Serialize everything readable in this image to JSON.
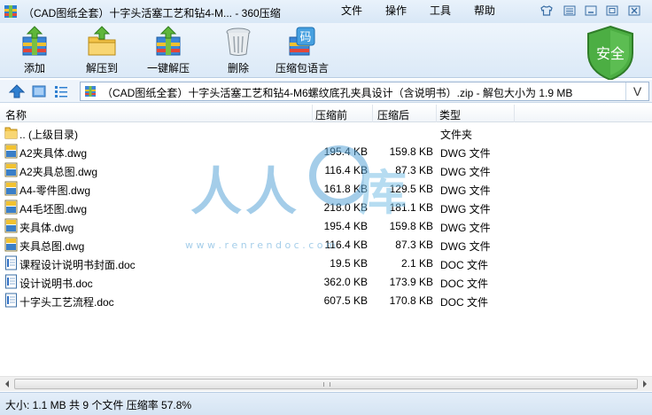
{
  "window": {
    "title": "（CAD图纸全套）十字头活塞工艺和钻4-M... - 360压缩",
    "app_icon": "archive-app-icon",
    "menu": [
      "文件",
      "操作",
      "工具",
      "帮助"
    ],
    "controls": [
      "shirt-icon",
      "menu-lines-icon",
      "minimize-icon",
      "maximize-icon",
      "close-icon"
    ]
  },
  "toolbar": {
    "buttons": [
      {
        "label": "添加",
        "icon": "add-to-archive-icon"
      },
      {
        "label": "解压到",
        "icon": "extract-to-folder-icon"
      },
      {
        "label": "一键解压",
        "icon": "one-click-extract-icon"
      },
      {
        "label": "删除",
        "icon": "trash-can-icon"
      },
      {
        "label": "压缩包语言",
        "icon": "archive-language-icon"
      }
    ],
    "lang_glyph": "码",
    "security_label": "安全",
    "security_color": "#3fa53a"
  },
  "address": {
    "text": "（CAD图纸全套）十字头活塞工艺和钻4-M6螺纹底孔夹具设计（含说明书）.zip - 解包大小为 1.9 MB",
    "dropdown_glyph": "V"
  },
  "columns": {
    "name": "名称",
    "size": "压缩前",
    "packed": "压缩后",
    "type": "类型"
  },
  "files": [
    {
      "name": ".. (上级目录)",
      "size": "",
      "packed": "",
      "type": "文件夹",
      "icon": "folder"
    },
    {
      "name": "A2夹具体.dwg",
      "size": "195.4 KB",
      "packed": "159.8 KB",
      "type": "DWG 文件",
      "icon": "dwg"
    },
    {
      "name": "A2夹具总图.dwg",
      "size": "116.4 KB",
      "packed": "87.3 KB",
      "type": "DWG 文件",
      "icon": "dwg"
    },
    {
      "name": "A4-零件图.dwg",
      "size": "161.8 KB",
      "packed": "129.5 KB",
      "type": "DWG 文件",
      "icon": "dwg"
    },
    {
      "name": "A4毛坯图.dwg",
      "size": "218.0 KB",
      "packed": "181.1 KB",
      "type": "DWG 文件",
      "icon": "dwg"
    },
    {
      "name": "夹具体.dwg",
      "size": "195.4 KB",
      "packed": "159.8 KB",
      "type": "DWG 文件",
      "icon": "dwg"
    },
    {
      "name": "夹具总图.dwg",
      "size": "116.4 KB",
      "packed": "87.3 KB",
      "type": "DWG 文件",
      "icon": "dwg"
    },
    {
      "name": "课程设计说明书封面.doc",
      "size": "19.5 KB",
      "packed": "2.1 KB",
      "type": "DOC 文件",
      "icon": "doc"
    },
    {
      "name": "设计说明书.doc",
      "size": "362.0 KB",
      "packed": "173.9 KB",
      "type": "DOC 文件",
      "icon": "doc"
    },
    {
      "name": "十字头工艺流程.doc",
      "size": "607.5 KB",
      "packed": "170.8 KB",
      "type": "DOC 文件",
      "icon": "doc"
    }
  ],
  "watermark": {
    "text": "人人文库",
    "url": "w w w . r e n r e n d o c . c o m",
    "color": "#5aa6d8"
  },
  "status": {
    "text": "大小: 1.1 MB 共 9 个文件 压缩率 57.8%"
  }
}
